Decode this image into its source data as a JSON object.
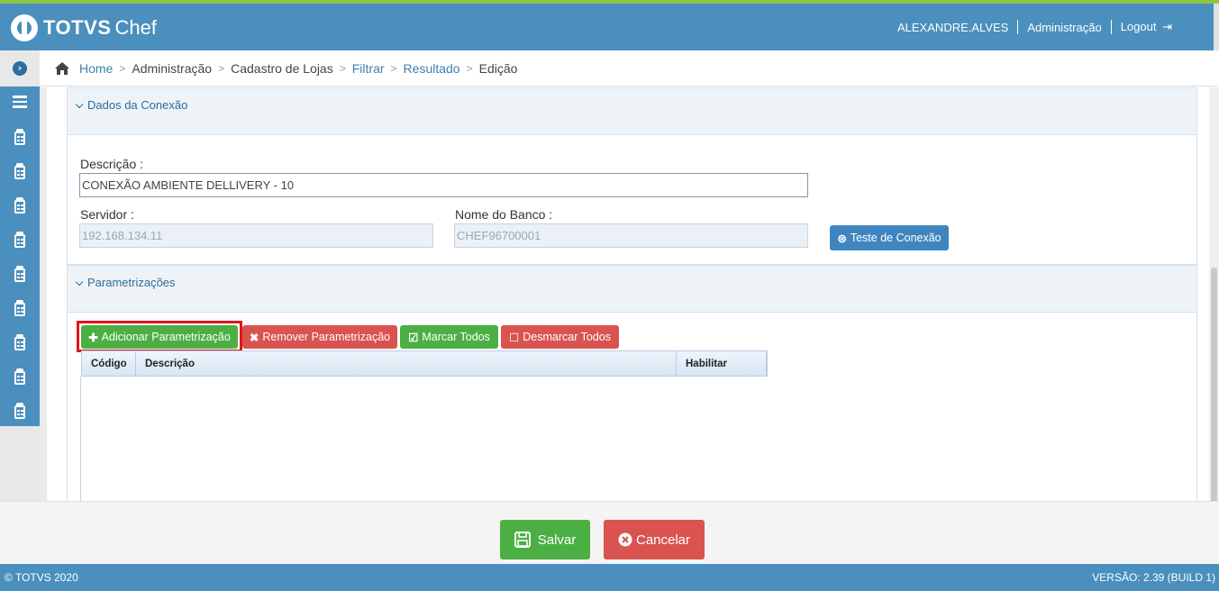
{
  "header": {
    "logo_text": "TOTVS",
    "logo_sub": "Chef",
    "user": "ALEXANDRE.ALVES",
    "admin_link": "Administração",
    "logout_link": "Logout"
  },
  "breadcrumb": {
    "items": [
      "Home",
      "Administração",
      "Cadastro de Lojas",
      "Filtrar",
      "Resultado",
      "Edição"
    ]
  },
  "connection_panel": {
    "title": "Dados da Conexão",
    "description_label": "Descrição :",
    "description_value": "CONEXÃO AMBIENTE DELLIVERY - 10",
    "server_label": "Servidor :",
    "server_value": "192.168.134.11",
    "database_label": "Nome do Banco :",
    "database_value": "CHEF96700001",
    "test_button": "Teste de Conexão"
  },
  "params_panel": {
    "title": "Parametrizações",
    "add_button": "Adicionar Parametrização",
    "remove_button": "Remover Parametrização",
    "check_all_button": "Marcar Todos",
    "uncheck_all_button": "Desmarcar Todos",
    "columns": [
      "Código",
      "Descrição",
      "Habilitar"
    ]
  },
  "actions": {
    "save": "Salvar",
    "cancel": "Cancelar"
  },
  "footer": {
    "copyright": "© TOTVS 2020",
    "version": "VERSÃO: 2.39 (BUILD 1)"
  },
  "colors": {
    "primary": "#4a8fbd",
    "accent": "#8ec63f",
    "success": "#4caf44",
    "danger": "#d9534f",
    "highlight": "#e0141c"
  }
}
